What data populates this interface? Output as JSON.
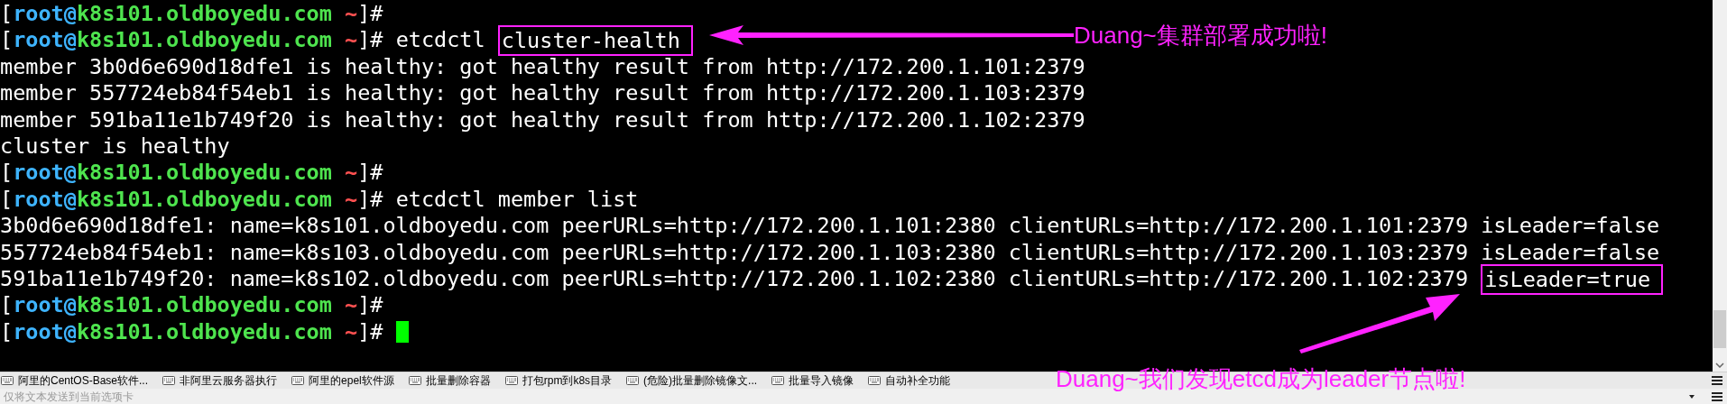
{
  "terminal": {
    "lines": [
      {
        "segments": [
          {
            "text": "[",
            "color": "#ffffff"
          },
          {
            "text": "root@",
            "color": "#3eb4ff"
          },
          {
            "text": "k8s101.oldboyedu.com ",
            "color": "#4ee44e"
          },
          {
            "text": "~",
            "color": "#ff5050"
          },
          {
            "text": "]#",
            "color": "#ffffff"
          }
        ]
      },
      {
        "segments": [
          {
            "text": "[",
            "color": "#ffffff"
          },
          {
            "text": "root@",
            "color": "#3eb4ff"
          },
          {
            "text": "k8s101.oldboyedu.com ",
            "color": "#4ee44e"
          },
          {
            "text": "~",
            "color": "#ff5050"
          },
          {
            "text": "]# etcdctl ",
            "color": "#ffffff"
          },
          {
            "text": "cluster-health",
            "color": "#ffffff",
            "boxed": true
          }
        ]
      },
      {
        "segments": [
          {
            "text": "member 3b0d6e690d18dfe1 is healthy: got healthy result from http://172.200.1.101:2379",
            "color": "#ffffff"
          }
        ]
      },
      {
        "segments": [
          {
            "text": "member 557724eb84f54eb1 is healthy: got healthy result from http://172.200.1.103:2379",
            "color": "#ffffff"
          }
        ]
      },
      {
        "segments": [
          {
            "text": "member 591ba11e1b749f20 is healthy: got healthy result from http://172.200.1.102:2379",
            "color": "#ffffff"
          }
        ]
      },
      {
        "segments": [
          {
            "text": "cluster is healthy",
            "color": "#ffffff"
          }
        ]
      },
      {
        "segments": [
          {
            "text": "[",
            "color": "#ffffff"
          },
          {
            "text": "root@",
            "color": "#3eb4ff"
          },
          {
            "text": "k8s101.oldboyedu.com ",
            "color": "#4ee44e"
          },
          {
            "text": "~",
            "color": "#ff5050"
          },
          {
            "text": "]#",
            "color": "#ffffff"
          }
        ]
      },
      {
        "segments": [
          {
            "text": "[",
            "color": "#ffffff"
          },
          {
            "text": "root@",
            "color": "#3eb4ff"
          },
          {
            "text": "k8s101.oldboyedu.com ",
            "color": "#4ee44e"
          },
          {
            "text": "~",
            "color": "#ff5050"
          },
          {
            "text": "]# etcdctl member list",
            "color": "#ffffff"
          }
        ]
      },
      {
        "segments": [
          {
            "text": "3b0d6e690d18dfe1: name=k8s101.oldboyedu.com peerURLs=http://172.200.1.101:2380 clientURLs=http://172.200.1.101:2379 isLeader=false",
            "color": "#ffffff"
          }
        ]
      },
      {
        "segments": [
          {
            "text": "557724eb84f54eb1: name=k8s103.oldboyedu.com peerURLs=http://172.200.1.103:2380 clientURLs=http://172.200.1.103:2379 isLeader=false",
            "color": "#ffffff"
          }
        ]
      },
      {
        "segments": [
          {
            "text": "591ba11e1b749f20: name=k8s102.oldboyedu.com peerURLs=http://172.200.1.102:2380 clientURLs=http://172.200.1.102:2379 ",
            "color": "#ffffff"
          },
          {
            "text": "isLeader=true",
            "color": "#ffffff",
            "boxed": true
          }
        ]
      },
      {
        "segments": [
          {
            "text": "[",
            "color": "#ffffff"
          },
          {
            "text": "root@",
            "color": "#3eb4ff"
          },
          {
            "text": "k8s101.oldboyedu.com ",
            "color": "#4ee44e"
          },
          {
            "text": "~",
            "color": "#ff5050"
          },
          {
            "text": "]#",
            "color": "#ffffff"
          }
        ]
      },
      {
        "segments": [
          {
            "text": "[",
            "color": "#ffffff"
          },
          {
            "text": "root@",
            "color": "#3eb4ff"
          },
          {
            "text": "k8s101.oldboyedu.com ",
            "color": "#4ee44e"
          },
          {
            "text": "~",
            "color": "#ff5050"
          },
          {
            "text": "]# ",
            "color": "#ffffff"
          }
        ],
        "cursor": true
      }
    ]
  },
  "callouts": [
    "Duang~集群部署成功啦!",
    "Duang~我们发现etcd成为leader节点啦!"
  ],
  "quick_commands": [
    "阿里的CentOS-Base软件...",
    "非阿里云服务器执行",
    "阿里的epel软件源",
    "批量删除容器",
    "打包rpm到k8s目录",
    "(危险)批量删除镜像文...",
    "批量导入镜像",
    "自动补全功能"
  ],
  "send_bar": {
    "placeholder": "仅将文本发送到当前选项卡"
  }
}
